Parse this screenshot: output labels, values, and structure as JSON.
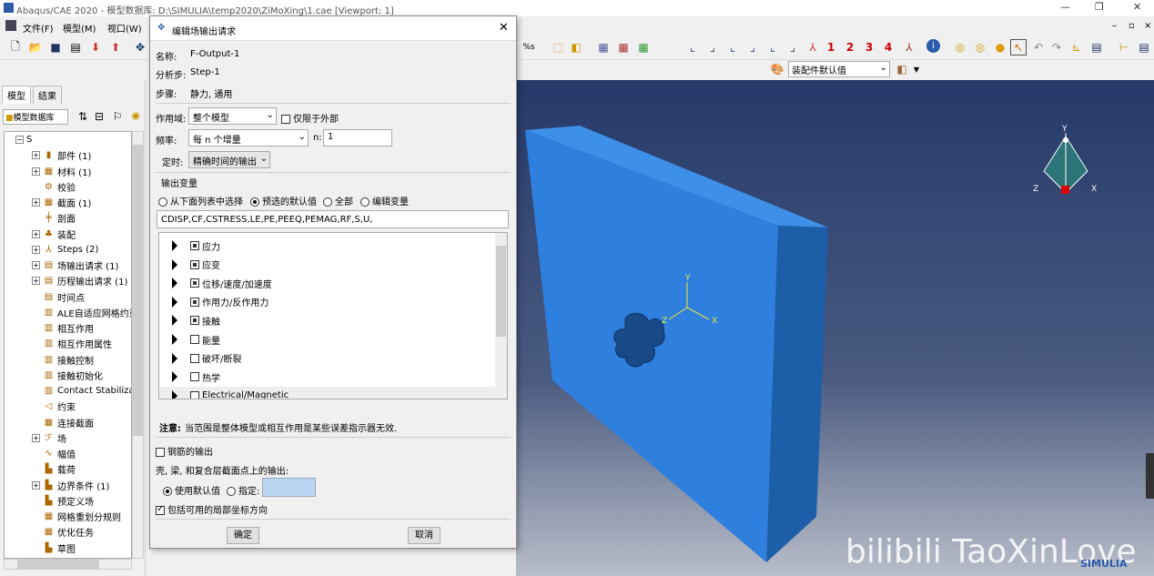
{
  "window": {
    "title": "Abaqus/CAE 2020 - 模型数据库: D:\\SIMULIA\\temp2020\\ZiMoXing\\1.cae [Viewport: 1]"
  },
  "menu": [
    "文件(F)",
    "模型(M)",
    "视口(W)"
  ],
  "toolbar_numbers": [
    "1",
    "2",
    "3",
    "4"
  ],
  "assembly_default": "装配件默认值",
  "left": {
    "tabs": [
      "模型",
      "结果"
    ],
    "dropdown": "模型数据库",
    "tree": [
      {
        "label": "S",
        "exp": "⊟"
      },
      {
        "label": "部件 (1)",
        "exp": "⊞"
      },
      {
        "label": "材料 (1)",
        "exp": "⊞"
      },
      {
        "label": "校验",
        "exp": ""
      },
      {
        "label": "截面 (1)",
        "exp": "⊞"
      },
      {
        "label": "剖面",
        "exp": ""
      },
      {
        "label": "装配",
        "exp": "⊞"
      },
      {
        "label": "Steps (2)",
        "exp": "⊞"
      },
      {
        "label": "场输出请求 (1)",
        "exp": "⊞"
      },
      {
        "label": "历程输出请求 (1)",
        "exp": "⊞"
      },
      {
        "label": "时间点",
        "exp": ""
      },
      {
        "label": "ALE自适应网格约束",
        "exp": ""
      },
      {
        "label": "相互作用",
        "exp": ""
      },
      {
        "label": "相互作用属性",
        "exp": ""
      },
      {
        "label": "接触控制",
        "exp": ""
      },
      {
        "label": "接触初始化",
        "exp": ""
      },
      {
        "label": "Contact Stabilization",
        "exp": ""
      },
      {
        "label": "约束",
        "exp": ""
      },
      {
        "label": "连接截面",
        "exp": ""
      },
      {
        "label": "场",
        "exp": "⊞"
      },
      {
        "label": "幅值",
        "exp": ""
      },
      {
        "label": "载荷",
        "exp": ""
      },
      {
        "label": "边界条件 (1)",
        "exp": "⊞"
      },
      {
        "label": "预定义场",
        "exp": ""
      },
      {
        "label": "网格重划分规则",
        "exp": ""
      },
      {
        "label": "优化任务",
        "exp": ""
      },
      {
        "label": "草图",
        "exp": ""
      }
    ]
  },
  "dialog": {
    "title": "编辑场输出请求",
    "name_label": "名称:",
    "name_value": "F-Output-1",
    "step_label": "分析步:",
    "step_value": "Step-1",
    "proc_label": "步骤:",
    "proc_value": "静力, 通用",
    "domain_label": "作用域:",
    "domain_value": "整个模型",
    "exterior_label": "仅限于外部",
    "freq_label": "频率:",
    "freq_value": "每 n 个增量",
    "n_label": "n:",
    "n_value": "1",
    "timing_label": "定时:",
    "timing_value": "精确时间的输出",
    "outvar_label": "输出变量",
    "radio": [
      "从下面列表中选择",
      "预选的默认值",
      "全部",
      "编辑变量"
    ],
    "vars_text": "CDISP,CF,CSTRESS,LE,PE,PEEQ,PEMAG,RF,S,U,",
    "vars": [
      {
        "label": "应力",
        "state": "fill"
      },
      {
        "label": "应变",
        "state": "fill"
      },
      {
        "label": "位移/速度/加速度",
        "state": "fill"
      },
      {
        "label": "作用力/反作用力",
        "state": "fill"
      },
      {
        "label": "接触",
        "state": "fill"
      },
      {
        "label": "能量",
        "state": "off"
      },
      {
        "label": "破坏/断裂",
        "state": "off"
      },
      {
        "label": "热学",
        "state": "off"
      },
      {
        "label": "Electrical/Magnetic",
        "state": "off"
      }
    ],
    "note_bold": "注意:",
    "note_text": "当范围是整体模型或相互作用是某些误差指示器无效.",
    "rebar_label": "钢筋的输出",
    "shell_label": "壳, 梁, 和复合层截面点上的输出:",
    "use_default": "使用默认值",
    "specify": "指定:",
    "local_label": "包括可用的局部坐标方向",
    "ok": "确定",
    "cancel": "取消"
  },
  "watermark": "bilibili TaoXinLove",
  "simulia": "SIMULIA",
  "triad": {
    "y": "Y",
    "x": "X",
    "z": "Z"
  },
  "colors": {
    "part": "#2f80e0",
    "viewport_top": "#253a6a"
  }
}
